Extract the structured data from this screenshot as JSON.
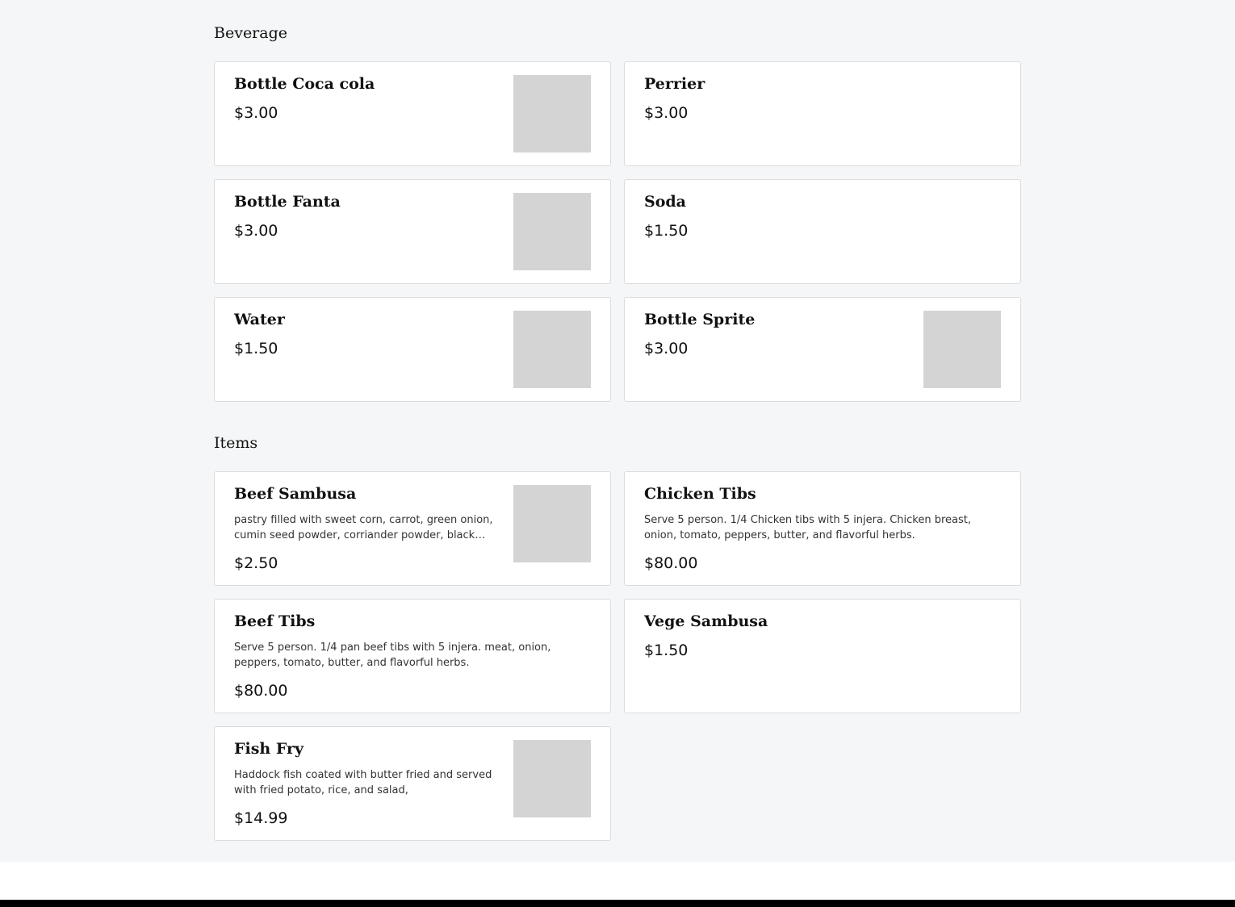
{
  "sections": [
    {
      "title": "Beverage",
      "items": [
        {
          "name": "Bottle Coca cola",
          "price": "$3.00",
          "image": true
        },
        {
          "name": "Perrier",
          "price": "$3.00",
          "image": false
        },
        {
          "name": "Bottle Fanta",
          "price": "$3.00",
          "image": true
        },
        {
          "name": "Soda",
          "price": "$1.50",
          "image": false
        },
        {
          "name": "Water",
          "price": "$1.50",
          "image": true
        },
        {
          "name": "Bottle Sprite",
          "price": "$3.00",
          "image": true
        }
      ]
    },
    {
      "title": "Items",
      "items": [
        {
          "name": "Beef Sambusa",
          "description": "pastry filled with sweet corn, carrot, green onion, cumin seed powder, corriander powder, black pepper, spices and vegetable oil.",
          "price": "$2.50",
          "image": true
        },
        {
          "name": "Chicken Tibs",
          "description": "Serve 5 person. 1/4 Chicken tibs with 5 injera. Chicken breast, onion, tomato, peppers, butter, and flavorful herbs.",
          "price": "$80.00",
          "image": false
        },
        {
          "name": "Beef Tibs",
          "description": "Serve 5 person. 1/4 pan beef tibs with 5 injera. meat, onion, peppers, tomato, butter, and flavorful herbs.",
          "price": "$80.00",
          "image": false
        },
        {
          "name": "Vege Sambusa",
          "description": "",
          "price": "$1.50",
          "image": false
        },
        {
          "name": "Fish Fry",
          "description": "Haddock fish coated with butter fried and served with fried potato, rice, and salad,",
          "price": "$14.99",
          "image": true
        }
      ]
    }
  ]
}
